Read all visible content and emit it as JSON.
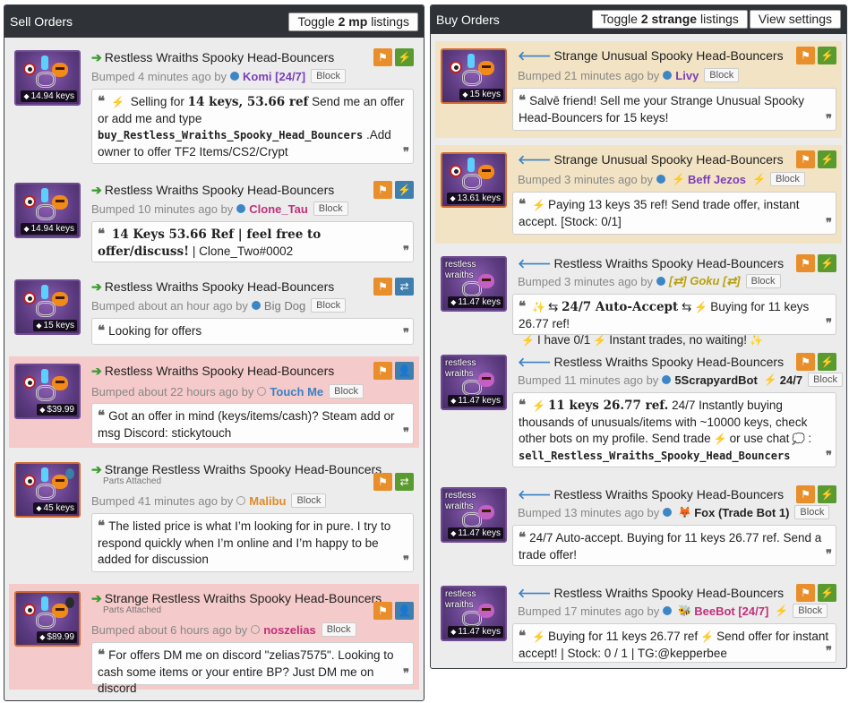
{
  "colors": {
    "sell_arrow": "#3a9b2e",
    "buy_arrow": "#3a82c4",
    "header_bg": "#2f3337",
    "highlight_red": "#f5caca",
    "highlight_tan": "#f2e3c4",
    "flag_button": "#e88e2a",
    "bolt_button": "#5a9b2f"
  },
  "sell": {
    "title": "Sell Orders",
    "toggle_pre": "Toggle ",
    "toggle_bold": "2 mp",
    "toggle_post": " listings",
    "listings": [
      {
        "name": "Restless Wraiths Spooky Head-Bouncers",
        "price": "14.94 keys",
        "bumped_prefix": "Bumped 4 minutes ago by",
        "user": "Komi [24/7]",
        "user_color": "#7b3fb8",
        "block": "Block",
        "comment": {
          "pre": "Selling for",
          "bold": "14 keys, 53.66 ref",
          "post": "Send me an offer or add me and type",
          "code": "buy_Restless_Wraiths_Spooky_Head_Bouncers",
          "tail": ".Add owner to offer TF2 Items/CS2/Crypt"
        }
      },
      {
        "name": "Restless Wraiths Spooky Head-Bouncers",
        "price": "14.94 keys",
        "bumped_prefix": "Bumped 10 minutes ago by",
        "user": "Clone_Tau",
        "user_color": "#c0307a",
        "block": "Block",
        "comment": {
          "bold": "14 Keys 53.66 Ref | feel free to offer/discuss!",
          "post": "| Clone_Two#0002"
        }
      },
      {
        "name": "Restless Wraiths Spooky Head-Bouncers",
        "price": "15 keys",
        "bumped_prefix": "Bumped about an hour ago by",
        "user": "Big Dog",
        "user_color": "#777777",
        "block": "Block",
        "comment": {
          "text": "Looking for offers"
        }
      },
      {
        "name": "Restless Wraiths Spooky Head-Bouncers",
        "price": "$39.99",
        "bumped_prefix": "Bumped about 22 hours ago by",
        "user": "Touch Me",
        "user_color": "#3a82c4",
        "block": "Block",
        "comment": {
          "text": "Got an offer in mind (keys/items/cash)? Steam add or msg Discord: stickytouch"
        }
      },
      {
        "name": "Strange Restless Wraiths Spooky Head-Bouncers",
        "parts": "Parts Attached",
        "price": "45 keys",
        "bumped_prefix": "Bumped 41 minutes ago by",
        "user": "Malibu",
        "user_color": "#e08a2a",
        "block": "Block",
        "comment": {
          "text": "The listed price is what I’m looking for in pure. I try to respond quickly when I’m online and I’m happy to be added for discussion"
        }
      },
      {
        "name": "Strange Restless Wraiths Spooky Head-Bouncers",
        "parts": "Parts Attached",
        "price": "$89.99",
        "bumped_prefix": "Bumped about 6 hours ago by",
        "user": "noszelias",
        "user_color": "#c0307a",
        "block": "Block",
        "comment": {
          "text": "For offers DM me on discord \"zelias7575\". Looking to cash some items or your entire BP? Just DM me on discord"
        }
      }
    ]
  },
  "buy": {
    "title": "Buy Orders",
    "toggle_pre": "Toggle ",
    "toggle_bold": "2 strange",
    "toggle_post": " listings",
    "view_settings": "View settings",
    "listings": [
      {
        "name": "Strange Unusual Spooky Head-Bouncers",
        "price": "15 keys",
        "bumped_prefix": "Bumped 21 minutes ago by",
        "user": "Livy",
        "user_color": "#7b3fb8",
        "block": "Block",
        "comment": {
          "text": "Salvē friend! Sell me your Strange Unusual Spooky Head-Bouncers for 15 keys!"
        }
      },
      {
        "name": "Strange Unusual Spooky Head-Bouncers",
        "price": "13.61 keys",
        "bumped_prefix": "Bumped 3 minutes ago by",
        "user": "Beff Jezos",
        "user_color": "#7b3fb8",
        "block": "Block",
        "comment": {
          "text": "Paying 13 keys 35 ref! Send trade offer, instant accept. [Stock: 0/1]"
        }
      },
      {
        "name": "Restless Wraiths Spooky Head-Bouncers",
        "price": "11.47 keys",
        "icon_label": "restless wraiths",
        "bumped_prefix": "Bumped 3 minutes ago by",
        "user": "[⇄] Goku [⇄]",
        "user_color": "#b8a012",
        "block": "Block",
        "comment": {
          "bold": "24/7 Auto-Accept",
          "post": "Buying for 11 keys 26.77 ref!",
          "line2_a": "I have 0/1",
          "line2_b": "Instant trades, no waiting!"
        }
      },
      {
        "name": "Restless Wraiths Spooky Head-Bouncers",
        "price": "11.47 keys",
        "icon_label": "restless wraiths",
        "bumped_prefix": "Bumped 11 minutes ago by",
        "user": "5ScrapyardBot",
        "user_suffix": "24/7",
        "user_color": "#222222",
        "block": "Block",
        "comment": {
          "bold": "11 keys 26.77 ref.",
          "post": "24/7 Instantly buying thousands of unusuals/items with ~10000 keys, check other bots on my profile. Send trade",
          "mid": "or use chat",
          "tail": ":",
          "code": "sell_Restless_Wraiths_Spooky_Head_Bouncers"
        }
      },
      {
        "name": "Restless Wraiths Spooky Head-Bouncers",
        "price": "11.47 keys",
        "icon_label": "restless wraiths",
        "bumped_prefix": "Bumped 13 minutes ago by",
        "user": "Fox (Trade Bot 1)",
        "user_color": "#222222",
        "block": "Block",
        "comment": {
          "text": "24/7 Auto-accept. Buying for 11 keys 26.77 ref. Send a trade offer!"
        }
      },
      {
        "name": "Restless Wraiths Spooky Head-Bouncers",
        "price": "11.47 keys",
        "icon_label": "restless wraiths",
        "bumped_prefix": "Bumped 17 minutes ago by",
        "user": "BeeBot [24/7]",
        "user_color": "#c0307a",
        "block": "Block",
        "comment": {
          "pre": "Buying for 11 keys 26.77 ref",
          "post": "Send offer for instant accept! | Stock: 0 / 1 | TG:@kepperbee"
        }
      }
    ]
  }
}
